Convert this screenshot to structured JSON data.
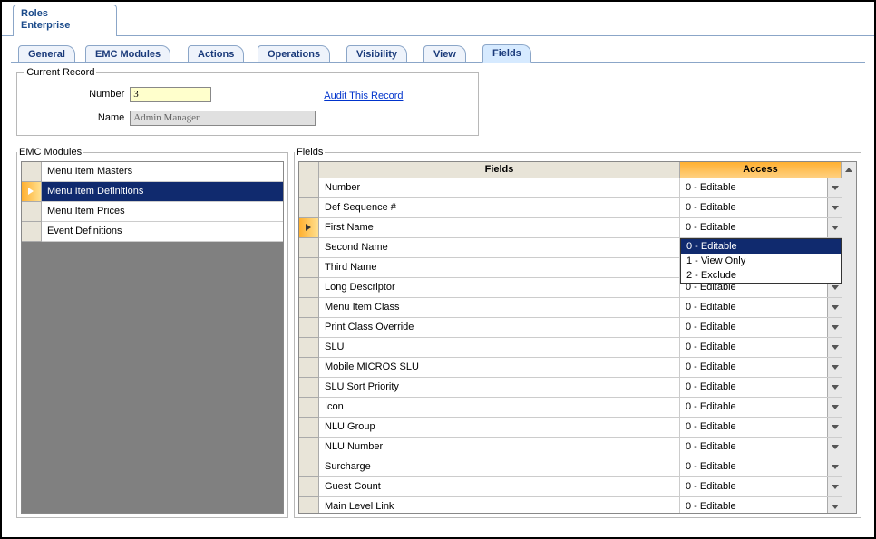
{
  "topTab": {
    "line1": "Roles",
    "line2": "Enterprise"
  },
  "subTabs": [
    "General",
    "EMC Modules",
    "Actions",
    "Operations",
    "Visibility",
    "View",
    "Fields"
  ],
  "currentRecord": {
    "legend": "Current Record",
    "numberLabel": "Number",
    "numberValue": "3",
    "nameLabel": "Name",
    "nameValue": "Admin Manager",
    "auditLink": "Audit This Record"
  },
  "emc": {
    "legend": "EMC Modules",
    "items": [
      "Menu Item Masters",
      "Menu Item Definitions",
      "Menu Item Prices",
      "Event Definitions"
    ]
  },
  "fields": {
    "legend": "Fields",
    "colFields": "Fields",
    "colAccess": "Access",
    "defaultAccess": "0 - Editable",
    "accessOptions": [
      "0 - Editable",
      "1 - View Only",
      "2 - Exclude"
    ],
    "selectedRowIndex": 2,
    "dropdownRowIndex": 3,
    "rows": [
      {
        "name": "Number",
        "access": "0 - Editable"
      },
      {
        "name": "Def Sequence #",
        "access": "0 - Editable"
      },
      {
        "name": "First Name",
        "access": "0 - Editable"
      },
      {
        "name": "Second Name",
        "access": ""
      },
      {
        "name": "Third Name",
        "access": ""
      },
      {
        "name": "Long Descriptor",
        "access": "0 - Editable"
      },
      {
        "name": "Menu Item Class",
        "access": "0 - Editable"
      },
      {
        "name": "Print Class Override",
        "access": "0 - Editable"
      },
      {
        "name": "SLU",
        "access": "0 - Editable"
      },
      {
        "name": "Mobile MICROS SLU",
        "access": "0 - Editable"
      },
      {
        "name": "SLU Sort Priority",
        "access": "0 - Editable"
      },
      {
        "name": "Icon",
        "access": "0 - Editable"
      },
      {
        "name": "NLU Group",
        "access": "0 - Editable"
      },
      {
        "name": "NLU Number",
        "access": "0 - Editable"
      },
      {
        "name": "Surcharge",
        "access": "0 - Editable"
      },
      {
        "name": "Guest Count",
        "access": "0 - Editable"
      },
      {
        "name": "Main Level Link",
        "access": "0 - Editable"
      }
    ]
  }
}
